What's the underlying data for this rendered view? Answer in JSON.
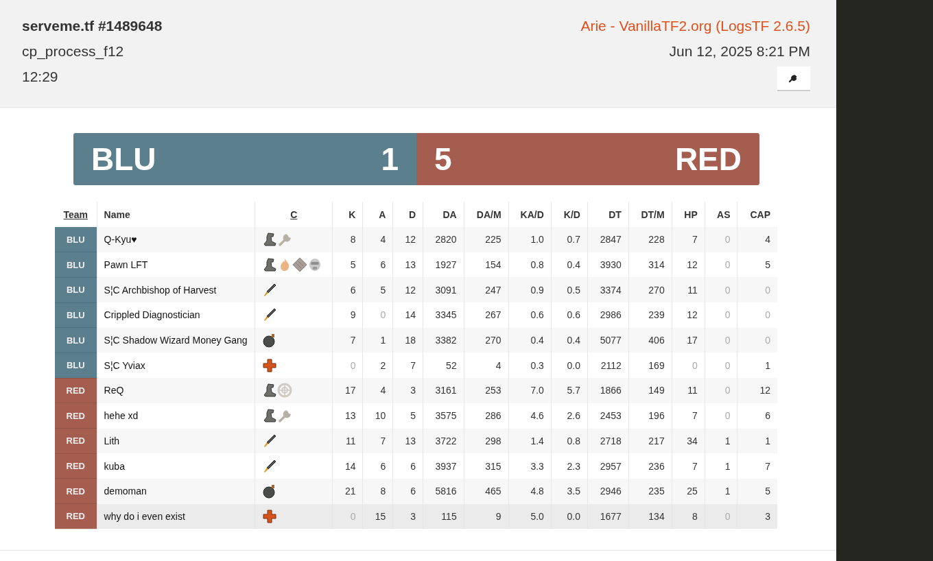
{
  "header": {
    "title": "serveme.tf #1489648",
    "map": "cp_process_f12",
    "duration": "12:29",
    "source": "Arie - VanillaTF2.org (LogsTF 2.6.5)",
    "date": "Jun 12, 2025 8:21 PM"
  },
  "score": {
    "blu": {
      "name": "BLU",
      "score": "1",
      "color": "#5b7f8c"
    },
    "red": {
      "name": "RED",
      "score": "5",
      "color": "#a55d50"
    }
  },
  "columns": [
    {
      "label": "Team",
      "link": true
    },
    {
      "label": "Name",
      "link": false
    },
    {
      "label": "C",
      "link": true
    },
    {
      "label": "K",
      "link": false
    },
    {
      "label": "A",
      "link": false
    },
    {
      "label": "D",
      "link": false
    },
    {
      "label": "DA",
      "link": false
    },
    {
      "label": "DA/M",
      "link": false
    },
    {
      "label": "KA/D",
      "link": false
    },
    {
      "label": "K/D",
      "link": false
    },
    {
      "label": "DT",
      "link": false
    },
    {
      "label": "DT/M",
      "link": false
    },
    {
      "label": "HP",
      "link": false
    },
    {
      "label": "AS",
      "link": false
    },
    {
      "label": "CAP",
      "link": false
    }
  ],
  "rows": [
    {
      "team": "BLU",
      "color": "#5b7f8c",
      "name": "Q-Kyu♥",
      "icons": [
        {
          "kind": "boot"
        },
        {
          "kind": "wrench"
        }
      ],
      "stats": [
        "8",
        "4",
        "12",
        "2820",
        "225",
        "1.0",
        "0.7",
        "2847",
        "228",
        "7",
        "0",
        "4"
      ],
      "selected": false
    },
    {
      "team": "BLU",
      "color": "#5b7f8c",
      "name": "Pawn LFT",
      "icons": [
        {
          "kind": "boot"
        },
        {
          "kind": "flame"
        },
        {
          "kind": "pills"
        },
        {
          "kind": "mask"
        }
      ],
      "stats": [
        "5",
        "6",
        "13",
        "1927",
        "154",
        "0.8",
        "0.4",
        "3930",
        "314",
        "12",
        "0",
        "5"
      ],
      "selected": false
    },
    {
      "team": "BLU",
      "color": "#5b7f8c",
      "name": "S¦C Archbishop of Harvest",
      "icons": [
        {
          "kind": "rocket"
        }
      ],
      "stats": [
        "6",
        "5",
        "12",
        "3091",
        "247",
        "0.9",
        "0.5",
        "3374",
        "270",
        "11",
        "0",
        "0"
      ],
      "selected": false
    },
    {
      "team": "BLU",
      "color": "#5b7f8c",
      "name": "Crippled Diagnostician",
      "icons": [
        {
          "kind": "rocket"
        }
      ],
      "stats": [
        "9",
        "0",
        "14",
        "3345",
        "267",
        "0.6",
        "0.6",
        "2986",
        "239",
        "12",
        "0",
        "0"
      ],
      "selected": false
    },
    {
      "team": "BLU",
      "color": "#5b7f8c",
      "name": "S¦C Shadow Wizard Money Gang",
      "icons": [
        {
          "kind": "bomb"
        }
      ],
      "stats": [
        "7",
        "1",
        "18",
        "3382",
        "270",
        "0.4",
        "0.4",
        "5077",
        "406",
        "17",
        "0",
        "0"
      ],
      "selected": false
    },
    {
      "team": "BLU",
      "color": "#5b7f8c",
      "name": "S¦C Yviax",
      "icons": [
        {
          "kind": "cross"
        }
      ],
      "stats": [
        "0",
        "2",
        "7",
        "52",
        "4",
        "0.3",
        "0.0",
        "2112",
        "169",
        "0",
        "0",
        "1"
      ],
      "selected": false
    },
    {
      "team": "RED",
      "color": "#a55d50",
      "name": "ReQ",
      "icons": [
        {
          "kind": "boot"
        },
        {
          "kind": "wheel"
        }
      ],
      "stats": [
        "17",
        "4",
        "3",
        "3161",
        "253",
        "7.0",
        "5.7",
        "1866",
        "149",
        "11",
        "0",
        "12"
      ],
      "selected": false
    },
    {
      "team": "RED",
      "color": "#a55d50",
      "name": "hehe xd",
      "icons": [
        {
          "kind": "boot"
        },
        {
          "kind": "wrench"
        }
      ],
      "stats": [
        "13",
        "10",
        "5",
        "3575",
        "286",
        "4.6",
        "2.6",
        "2453",
        "196",
        "7",
        "0",
        "6"
      ],
      "selected": false
    },
    {
      "team": "RED",
      "color": "#a55d50",
      "name": "Lith",
      "icons": [
        {
          "kind": "rocket"
        }
      ],
      "stats": [
        "11",
        "7",
        "13",
        "3722",
        "298",
        "1.4",
        "0.8",
        "2718",
        "217",
        "34",
        "1",
        "1"
      ],
      "selected": false
    },
    {
      "team": "RED",
      "color": "#a55d50",
      "name": "kuba",
      "icons": [
        {
          "kind": "rocket"
        }
      ],
      "stats": [
        "14",
        "6",
        "6",
        "3937",
        "315",
        "3.3",
        "2.3",
        "2957",
        "236",
        "7",
        "1",
        "7"
      ],
      "selected": false
    },
    {
      "team": "RED",
      "color": "#a55d50",
      "name": "demoman",
      "icons": [
        {
          "kind": "bomb"
        }
      ],
      "stats": [
        "21",
        "8",
        "6",
        "5816",
        "465",
        "4.8",
        "3.5",
        "2946",
        "235",
        "25",
        "1",
        "5"
      ],
      "selected": false
    },
    {
      "team": "RED",
      "color": "#a55d50",
      "name": "why do i even exist",
      "icons": [
        {
          "kind": "cross"
        }
      ],
      "stats": [
        "0",
        "15",
        "3",
        "115",
        "9",
        "5.0",
        "0.0",
        "1677",
        "134",
        "8",
        "0",
        "3"
      ],
      "selected": true
    }
  ]
}
